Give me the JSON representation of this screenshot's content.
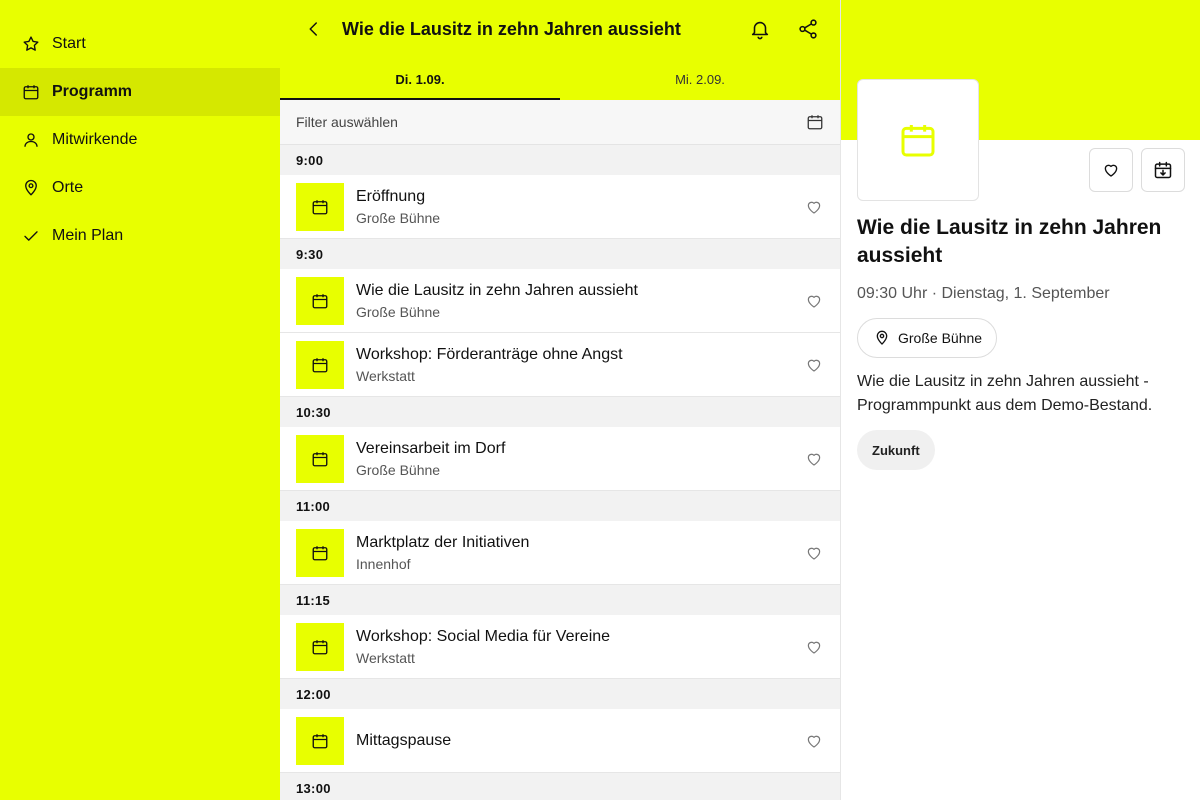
{
  "sidebar": {
    "items": [
      {
        "label": "Start",
        "icon": "star-icon"
      },
      {
        "label": "Programm",
        "icon": "calendar-icon",
        "active": true
      },
      {
        "label": "Mitwirkende",
        "icon": "person-icon"
      },
      {
        "label": "Orte",
        "icon": "map-pin-icon"
      },
      {
        "label": "Mein Plan",
        "icon": "check-icon"
      }
    ]
  },
  "header": {
    "title": "Wie die Lausitz in zehn Jahren aussieht"
  },
  "tabs": [
    {
      "label": "Di. 1.09.",
      "active": true
    },
    {
      "label": "Mi. 2.09.",
      "active": false
    }
  ],
  "filter": {
    "label": "Filter auswählen"
  },
  "schedule": [
    {
      "time": "9:00",
      "events": [
        {
          "name": "Eröffnung",
          "place": "Große Bühne"
        }
      ]
    },
    {
      "time": "9:30",
      "events": [
        {
          "name": "Wie die Lausitz in zehn Jahren aussieht",
          "place": "Große Bühne"
        },
        {
          "name": "Workshop: Förderanträge ohne Angst",
          "place": "Werkstatt"
        }
      ]
    },
    {
      "time": "10:30",
      "events": [
        {
          "name": "Vereinsarbeit im Dorf",
          "place": "Große Bühne"
        }
      ]
    },
    {
      "time": "11:00",
      "events": [
        {
          "name": "Marktplatz der Initiativen",
          "place": "Innenhof"
        }
      ]
    },
    {
      "time": "11:15",
      "events": [
        {
          "name": "Workshop: Social Media für Vereine",
          "place": "Werkstatt"
        }
      ]
    },
    {
      "time": "12:00",
      "events": [
        {
          "name": "Mittagspause",
          "place": ""
        }
      ]
    },
    {
      "time": "13:00",
      "events": []
    }
  ],
  "detail": {
    "title": "Wie die Lausitz in zehn Jahren aussieht",
    "time": "09:30 Uhr · Dienstag, 1. September",
    "location": "Große Bühne",
    "description": "Wie die Lausitz in zehn Jahren aussieht - Programmpunkt aus dem Demo-Bestand.",
    "tag": "Zukunft"
  },
  "colors": {
    "accent": "#e8ff00",
    "accent_active": "#d5e800",
    "list_background": "#f2f2f2"
  }
}
